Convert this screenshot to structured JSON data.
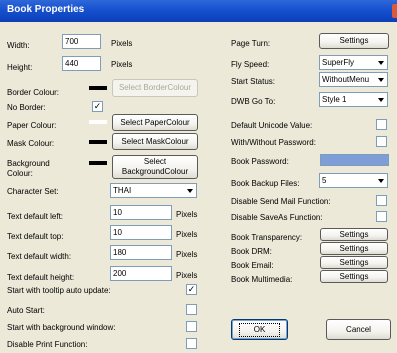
{
  "window": {
    "title": "Book Properties"
  },
  "left": {
    "width_label": "Width:",
    "width_value": "700",
    "width_unit": "Pixels",
    "height_label": "Height:",
    "height_value": "440",
    "height_unit": "Pixels",
    "border_colour_label": "Border Colour:",
    "border_colour_button": "Select BorderColour",
    "no_border_label": "No Border:",
    "no_border_checked": "✓",
    "paper_colour_label": "Paper Colour:",
    "paper_colour_button": "Select PaperColour",
    "mask_colour_label": "Mask Colour:",
    "mask_colour_button": "Select MaskColour",
    "background_colour_label": "Background Colour:",
    "background_colour_button": "Select BackgroundColour",
    "charset_label": "Character Set:",
    "charset_value": "THAI",
    "text_left_label": "Text default left:",
    "text_left_value": "10",
    "text_left_unit": "Pixels",
    "text_top_label": "Text default top:",
    "text_top_value": "10",
    "text_top_unit": "Pixels",
    "text_width_label": "Text default width:",
    "text_width_value": "180",
    "text_width_unit": "Pixels",
    "text_height_label": "Text default height:",
    "text_height_value": "200",
    "text_height_unit": "Pixels",
    "tooltip_label": "Start with tooltip auto update:",
    "tooltip_checked": "✓",
    "autostart_label": "Auto Start:",
    "bgwindow_label": "Start with background window:",
    "disable_print_label": "Disable Print Function:"
  },
  "right": {
    "page_turn_label": "Page Turn:",
    "page_turn_button": "Settings",
    "fly_speed_label": "Fly Speed:",
    "fly_speed_value": "SuperFly",
    "start_status_label": "Start Status:",
    "start_status_value": "WithoutMenu",
    "dwb_goto_label": "DWB Go To:",
    "dwb_goto_value": "Style 1",
    "unicode_label": "Default Unicode Value:",
    "with_password_label": "With/Without Password:",
    "book_password_label": "Book Password:",
    "backup_label": "Book Backup Files:",
    "backup_value": "5",
    "disable_mail_label": "Disable Send Mail Function:",
    "disable_saveas_label": "Disable SaveAs Function:",
    "transparency_label": "Book Transparency:",
    "transparency_button": "Settings",
    "drm_label": "Book DRM:",
    "drm_button": "Settings",
    "email_label": "Book Email:",
    "email_button": "Settings",
    "multimedia_label": "Book Multimedia:",
    "multimedia_button": "Settings",
    "ok_button": "OK",
    "cancel_button": "Cancel"
  },
  "colors": {
    "border_colour": "#000000",
    "paper_colour": "#FFFFFF",
    "mask_colour": "#000000",
    "background_colour": "#000000",
    "password_field": "#7F9ED8"
  }
}
